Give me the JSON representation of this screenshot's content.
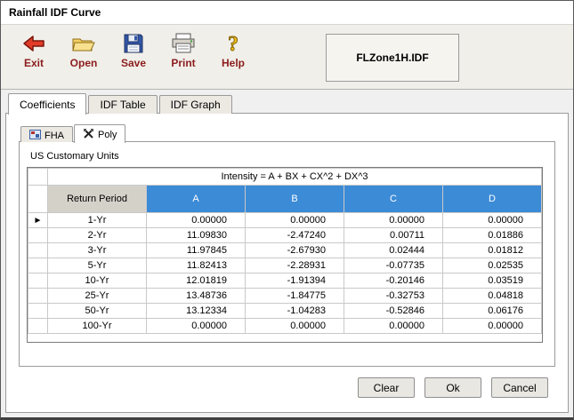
{
  "window": {
    "title": "Rainfall IDF Curve"
  },
  "toolbar": {
    "buttons": [
      {
        "label": "Exit"
      },
      {
        "label": "Open"
      },
      {
        "label": "Save"
      },
      {
        "label": "Print"
      },
      {
        "label": "Help"
      }
    ],
    "filename": "FLZone1H.IDF"
  },
  "tabs": [
    {
      "label": "Coefficients",
      "active": true
    },
    {
      "label": "IDF Table",
      "active": false
    },
    {
      "label": "IDF Graph",
      "active": false
    }
  ],
  "subtabs": [
    {
      "label": "FHA",
      "active": false
    },
    {
      "label": "Poly",
      "active": true
    }
  ],
  "content": {
    "units_label": "US Customary Units"
  },
  "table": {
    "formula": "Intensity = A + BX + CX^2 + DX^3",
    "columns": {
      "period": "Return\nPeriod",
      "a": "A",
      "b": "B",
      "c": "C",
      "d": "D"
    },
    "selected_row": 0,
    "rows": [
      [
        "1-Yr",
        "0.00000",
        "0.00000",
        "0.00000",
        "0.00000"
      ],
      [
        "2-Yr",
        "11.09830",
        "-2.47240",
        "0.00711",
        "0.01886"
      ],
      [
        "3-Yr",
        "11.97845",
        "-2.67930",
        "0.02444",
        "0.01812"
      ],
      [
        "5-Yr",
        "11.82413",
        "-2.28931",
        "-0.07735",
        "0.02535"
      ],
      [
        "10-Yr",
        "12.01819",
        "-1.91394",
        "-0.20146",
        "0.03519"
      ],
      [
        "25-Yr",
        "13.48736",
        "-1.84775",
        "-0.32753",
        "0.04818"
      ],
      [
        "50-Yr",
        "13.12334",
        "-1.04283",
        "-0.52846",
        "0.06176"
      ],
      [
        "100-Yr",
        "0.00000",
        "0.00000",
        "0.00000",
        "0.00000"
      ]
    ]
  },
  "footer_buttons": {
    "clear": "Clear",
    "ok": "Ok",
    "cancel": "Cancel"
  },
  "icons": {
    "row_selector": "►"
  },
  "colors": {
    "grid_header_blue": "#3c8bd6",
    "toolbar_label_red": "#8b1d1d",
    "period_header_gray": "#d4d1c9"
  }
}
